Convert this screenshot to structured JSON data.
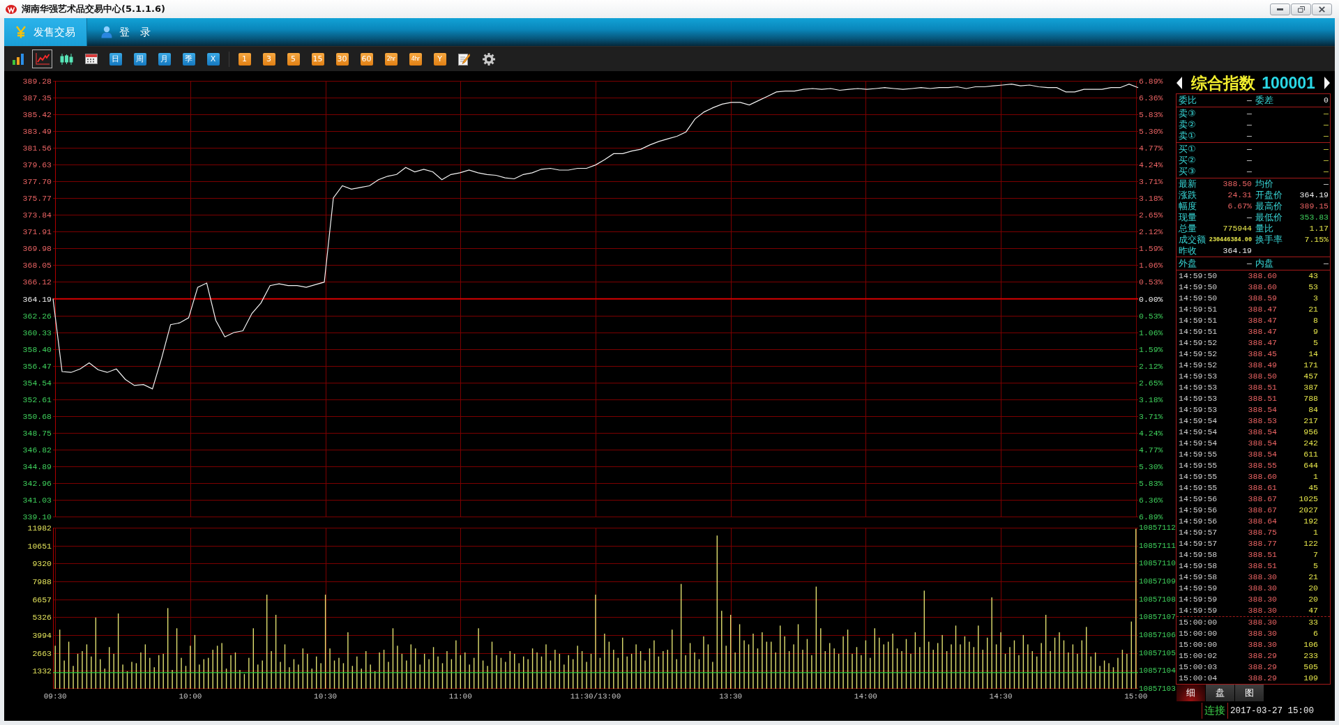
{
  "window": {
    "title": "湖南华强艺术品交易中心(5.1.1.6)"
  },
  "nav_tabs": [
    {
      "label": "发售交易",
      "selected": true
    },
    {
      "label": "登　录",
      "selected": false
    }
  ],
  "toolbar": {
    "chart_buttons": [
      {
        "selected": false
      },
      {
        "selected": true
      },
      {
        "selected": false
      },
      {
        "selected": false
      }
    ],
    "period_buttons": [
      {
        "label": "日"
      },
      {
        "label": "周"
      },
      {
        "label": "月"
      },
      {
        "label": "季"
      },
      {
        "label": "X"
      }
    ],
    "interval_buttons": [
      {
        "label": "1"
      },
      {
        "label": "3"
      },
      {
        "label": "5"
      },
      {
        "label": "15"
      },
      {
        "label": "30"
      },
      {
        "label": "60"
      },
      {
        "label": "2hr"
      },
      {
        "label": "4hr"
      },
      {
        "label": "Y"
      }
    ]
  },
  "price_chart": {
    "chart_data": {
      "type": "line",
      "grid": true,
      "ylim": [
        339.1,
        389.28
      ],
      "yticks": [
        {
          "value": 389.28,
          "label": "389.28"
        },
        {
          "value": 387.35,
          "label": "387.35"
        },
        {
          "value": 385.42,
          "label": "385.42"
        },
        {
          "value": 383.49,
          "label": "383.49"
        },
        {
          "value": 381.56,
          "label": "381.56"
        },
        {
          "value": 379.63,
          "label": "379.63"
        },
        {
          "value": 377.7,
          "label": "377.70"
        },
        {
          "value": 375.77,
          "label": "375.77"
        },
        {
          "value": 373.84,
          "label": "373.84"
        },
        {
          "value": 371.91,
          "label": "371.91"
        },
        {
          "value": 369.98,
          "label": "369.98"
        },
        {
          "value": 368.05,
          "label": "368.05"
        },
        {
          "value": 366.12,
          "label": "366.12"
        },
        {
          "value": 364.19,
          "label": "364.19"
        },
        {
          "value": 362.26,
          "label": "362.26"
        },
        {
          "value": 360.33,
          "label": "360.33"
        },
        {
          "value": 358.4,
          "label": "358.40"
        },
        {
          "value": 356.47,
          "label": "356.47"
        },
        {
          "value": 354.54,
          "label": "354.54"
        },
        {
          "value": 352.61,
          "label": "352.61"
        },
        {
          "value": 350.68,
          "label": "350.68"
        },
        {
          "value": 348.75,
          "label": "348.75"
        },
        {
          "value": 346.82,
          "label": "346.82"
        },
        {
          "value": 344.89,
          "label": "344.89"
        },
        {
          "value": 342.96,
          "label": "342.96"
        },
        {
          "value": 341.03,
          "label": "341.03"
        },
        {
          "value": 339.1,
          "label": "339.10"
        }
      ],
      "values": [
        364.2,
        355.8,
        355.7,
        356.1,
        356.8,
        356.0,
        355.7,
        356.1,
        354.9,
        354.2,
        354.3,
        353.8,
        357.3,
        361.2,
        361.4,
        362.0,
        365.5,
        366.0,
        361.7,
        359.8,
        360.3,
        360.5,
        362.5,
        363.7,
        365.7,
        365.9,
        365.7,
        365.7,
        365.5,
        365.8,
        366.1,
        375.8,
        377.2,
        376.8,
        377.0,
        377.2,
        377.9,
        378.3,
        378.5,
        379.3,
        378.8,
        379.1,
        378.8,
        377.9,
        378.5,
        378.7,
        379.0,
        378.7,
        378.5,
        378.4,
        378.1,
        378.0,
        378.5,
        378.7,
        379.1,
        379.2,
        379.0,
        379.0,
        379.2,
        379.2,
        379.6,
        380.2,
        380.9,
        380.9,
        381.2,
        381.4,
        381.9,
        382.3,
        382.6,
        382.9,
        383.4,
        384.9,
        385.7,
        386.2,
        386.6,
        386.8,
        386.8,
        386.5,
        387.0,
        387.5,
        388.0,
        388.1,
        388.1,
        388.3,
        388.4,
        388.3,
        388.4,
        388.2,
        388.3,
        388.4,
        388.3,
        388.4,
        388.5,
        388.4,
        388.3,
        388.4,
        388.5,
        388.4,
        388.5,
        388.5,
        388.6,
        388.4,
        388.6,
        388.6,
        388.7,
        388.8,
        388.9,
        388.7,
        388.8,
        388.6,
        388.5,
        388.5,
        388.0,
        388.0,
        388.3,
        388.3,
        388.3,
        388.5,
        388.5,
        388.9,
        388.5
      ],
      "ref_lines": [
        {
          "axis": "y",
          "value": 364.19
        }
      ]
    },
    "right_axis_labels": [
      "6.89%",
      "6.36%",
      "5.83%",
      "5.30%",
      "4.77%",
      "4.24%",
      "3.71%",
      "3.18%",
      "2.65%",
      "2.12%",
      "1.59%",
      "1.06%",
      "0.53%",
      "0.00%",
      "0.53%",
      "1.06%",
      "1.59%",
      "2.12%",
      "2.65%",
      "3.18%",
      "3.71%",
      "4.24%",
      "4.77%",
      "5.30%",
      "5.83%",
      "6.36%",
      "6.89%"
    ]
  },
  "volume_chart": {
    "chart_data": {
      "type": "bar",
      "grid": true,
      "ylim": [
        0,
        11982
      ],
      "yticks": [
        1332,
        2663,
        3994,
        5326,
        6657,
        7988,
        9320,
        10651,
        11982
      ],
      "categories": [
        "09:30",
        null,
        null,
        null,
        null,
        null,
        null,
        null,
        null,
        null,
        null,
        null,
        null,
        null,
        null,
        null,
        null,
        null,
        null,
        null,
        null,
        null,
        null,
        null,
        null,
        null,
        null,
        null,
        null,
        null,
        "10:00",
        null,
        null,
        null,
        null,
        null,
        null,
        null,
        null,
        null,
        null,
        null,
        null,
        null,
        null,
        null,
        null,
        null,
        null,
        null,
        null,
        null,
        null,
        null,
        null,
        null,
        null,
        null,
        null,
        null,
        "10:30",
        null,
        null,
        null,
        null,
        null,
        null,
        null,
        null,
        null,
        null,
        null,
        null,
        null,
        null,
        null,
        null,
        null,
        null,
        null,
        null,
        null,
        null,
        null,
        null,
        null,
        null,
        null,
        null,
        null,
        "11:00",
        null,
        null,
        null,
        null,
        null,
        null,
        null,
        null,
        null,
        null,
        null,
        null,
        null,
        null,
        null,
        null,
        null,
        null,
        null,
        null,
        null,
        null,
        null,
        null,
        null,
        null,
        null,
        null,
        null,
        "11:30/13:00",
        null,
        null,
        null,
        null,
        null,
        null,
        null,
        null,
        null,
        null,
        null,
        null,
        null,
        null,
        null,
        null,
        null,
        null,
        null,
        null,
        null,
        null,
        null,
        null,
        null,
        null,
        null,
        null,
        null,
        "13:30",
        null,
        null,
        null,
        null,
        null,
        null,
        null,
        null,
        null,
        null,
        null,
        null,
        null,
        null,
        null,
        null,
        null,
        null,
        null,
        null,
        null,
        null,
        null,
        null,
        null,
        null,
        null,
        null,
        null,
        "14:00",
        null,
        null,
        null,
        null,
        null,
        null,
        null,
        null,
        null,
        null,
        null,
        null,
        null,
        null,
        null,
        null,
        null,
        null,
        null,
        null,
        null,
        null,
        null,
        null,
        null,
        null,
        null,
        null,
        null,
        "14:30",
        null,
        null,
        null,
        null,
        null,
        null,
        null,
        null,
        null,
        null,
        null,
        null,
        null,
        null,
        null,
        null,
        null,
        null,
        null,
        null,
        null,
        null,
        null,
        null,
        null,
        null,
        null,
        null,
        null,
        "15:00"
      ],
      "values": [
        3200,
        4400,
        2100,
        3500,
        1700,
        2600,
        2800,
        3300,
        2400,
        5300,
        2200,
        1500,
        3100,
        2600,
        5600,
        1800,
        1300,
        2000,
        1900,
        2700,
        3300,
        2300,
        1600,
        2500,
        2600,
        6000,
        1400,
        4500,
        2300,
        1700,
        3200,
        4000,
        1800,
        2200,
        2300,
        2900,
        3200,
        3400,
        1500,
        2500,
        2700,
        1400,
        1100,
        2300,
        4500,
        1800,
        2100,
        7000,
        2800,
        5500,
        2000,
        3300,
        1600,
        2200,
        1800,
        3000,
        2600,
        1500,
        2400,
        1900,
        7000,
        3000,
        2100,
        2300,
        1900,
        4200,
        1700,
        2400,
        1500,
        2800,
        1800,
        1300,
        2700,
        2900,
        2000,
        4500,
        3200,
        2600,
        2100,
        3300,
        3000,
        1800,
        2600,
        2200,
        3100,
        2400,
        1900,
        2800,
        2200,
        3600,
        2500,
        2700,
        1800,
        2300,
        4500,
        2100,
        1700,
        3500,
        2500,
        2300,
        2000,
        2800,
        2600,
        1900,
        2400,
        2200,
        3000,
        2700,
        2400,
        3300,
        2100,
        2900,
        2600,
        1800,
        2500,
        2200,
        3200,
        2800,
        2000,
        2600,
        7000,
        2300,
        4100,
        3500,
        2900,
        2300,
        3800,
        2400,
        2600,
        3300,
        2800,
        2100,
        3000,
        3600,
        2400,
        2800,
        2900,
        4400,
        2200,
        7800,
        2500,
        3400,
        2700,
        2200,
        3900,
        3300,
        2000,
        11400,
        5800,
        3200,
        5500,
        2700,
        4800,
        3600,
        3300,
        4100,
        3000,
        4200,
        3500,
        3500,
        2700,
        4700,
        3900,
        2800,
        3300,
        4800,
        2900,
        3700,
        2500,
        7600,
        4500,
        2800,
        3400,
        3000,
        2600,
        3900,
        4400,
        2600,
        3100,
        2500,
        3600,
        2300,
        4500,
        3800,
        3300,
        3500,
        4100,
        3000,
        2800,
        3700,
        2600,
        4200,
        3100,
        7300,
        3500,
        2900,
        3400,
        4000,
        2800,
        3300,
        4700,
        3300,
        3900,
        3500,
        3100,
        4700,
        2900,
        3800,
        6800,
        3300,
        4200,
        2600,
        3100,
        3600,
        2500,
        4000,
        3300,
        2800,
        2400,
        3400,
        5500,
        2800,
        3800,
        4200,
        3600,
        2700,
        3300,
        2600,
        3600,
        4600,
        2400,
        2700,
        1700,
        2100,
        1900,
        1600,
        2300,
        2900,
        2600,
        5000,
        11900
      ],
      "ref_lines": [
        {
          "axis": "y",
          "value": 1200
        }
      ]
    },
    "right_axis_labels": [
      "10857112",
      "10857111",
      "10857110",
      "10857109",
      "10857108",
      "10857107",
      "10857106",
      "10857105",
      "10857104",
      "10857103"
    ]
  },
  "quote_panel": {
    "name": "综合指数",
    "code": "100001",
    "sections": [
      {
        "rows": [
          {
            "kind": "pair",
            "cells": [
              {
                "label": "委比",
                "value": "—"
              },
              {
                "label": "委差",
                "value": "0"
              }
            ]
          }
        ]
      },
      {
        "rows": [
          {
            "kind": "level",
            "label": "卖③",
            "price": "—",
            "volume": "—"
          },
          {
            "kind": "level",
            "label": "卖②",
            "price": "—",
            "volume": "—"
          },
          {
            "kind": "level",
            "label": "卖①",
            "price": "—",
            "volume": "—"
          }
        ]
      },
      {
        "rows": [
          {
            "kind": "level",
            "label": "买①",
            "price": "—",
            "volume": "—"
          },
          {
            "kind": "level",
            "label": "买②",
            "price": "—",
            "volume": "—"
          },
          {
            "kind": "level",
            "label": "买③",
            "price": "—",
            "volume": "—"
          }
        ]
      },
      {
        "rows": [
          {
            "kind": "pair",
            "cells": [
              {
                "label": "最新",
                "value": "388.50",
                "color": "#ec6464"
              },
              {
                "label": "均价",
                "value": "—"
              }
            ]
          },
          {
            "kind": "pair",
            "cells": [
              {
                "label": "涨跌",
                "value": "24.31",
                "color": "#ec6464"
              },
              {
                "label": "开盘价",
                "value": "364.19"
              }
            ]
          },
          {
            "kind": "pair",
            "cells": [
              {
                "label": "幅度",
                "value": "6.67%",
                "color": "#ec6464"
              },
              {
                "label": "最高价",
                "value": "389.15",
                "color": "#ec6464"
              }
            ]
          },
          {
            "kind": "pair",
            "cells": [
              {
                "label": "现量",
                "value": "—"
              },
              {
                "label": "最低价",
                "value": "353.83",
                "color": "#3fd15c"
              }
            ]
          },
          {
            "kind": "pair",
            "cells": [
              {
                "label": "总量",
                "value": "775944",
                "color": "#e8e84c"
              },
              {
                "label": "量比",
                "value": "1.17",
                "color": "#e8e84c"
              }
            ]
          },
          {
            "kind": "pair",
            "cells": [
              {
                "label": "成交额",
                "value": "230446384.00",
                "color": "#e8e84c"
              },
              {
                "label": "换手率",
                "value": "7.15%",
                "color": "#e8e84c"
              }
            ]
          },
          {
            "kind": "pair",
            "cells": [
              {
                "label": "昨收",
                "value": "364.19"
              }
            ]
          }
        ]
      },
      {
        "rows": [
          {
            "kind": "pair",
            "cells": [
              {
                "label": "外盘",
                "value": "—"
              },
              {
                "label": "内盘",
                "value": "—"
              }
            ]
          }
        ]
      }
    ],
    "tick_groups": [
      {
        "rows": [
          {
            "time": "14:59:50",
            "price": "388.60",
            "volume": "43"
          },
          {
            "time": "14:59:50",
            "price": "388.60",
            "volume": "53"
          },
          {
            "time": "14:59:50",
            "price": "388.59",
            "volume": "3"
          },
          {
            "time": "14:59:51",
            "price": "388.47",
            "volume": "21"
          },
          {
            "time": "14:59:51",
            "price": "388.47",
            "volume": "8"
          },
          {
            "time": "14:59:51",
            "price": "388.47",
            "volume": "9"
          },
          {
            "time": "14:59:52",
            "price": "388.47",
            "volume": "5"
          },
          {
            "time": "14:59:52",
            "price": "388.45",
            "volume": "14"
          },
          {
            "time": "14:59:52",
            "price": "388.49",
            "volume": "171"
          },
          {
            "time": "14:59:53",
            "price": "388.50",
            "volume": "457"
          },
          {
            "time": "14:59:53",
            "price": "388.51",
            "volume": "387"
          },
          {
            "time": "14:59:53",
            "price": "388.51",
            "volume": "788"
          },
          {
            "time": "14:59:53",
            "price": "388.54",
            "volume": "84"
          },
          {
            "time": "14:59:54",
            "price": "388.53",
            "volume": "217"
          },
          {
            "time": "14:59:54",
            "price": "388.54",
            "volume": "956"
          },
          {
            "time": "14:59:54",
            "price": "388.54",
            "volume": "242"
          },
          {
            "time": "14:59:55",
            "price": "388.54",
            "volume": "611"
          },
          {
            "time": "14:59:55",
            "price": "388.55",
            "volume": "644"
          },
          {
            "time": "14:59:55",
            "price": "388.60",
            "volume": "1"
          },
          {
            "time": "14:59:55",
            "price": "388.61",
            "volume": "45"
          },
          {
            "time": "14:59:56",
            "price": "388.67",
            "volume": "1025"
          },
          {
            "time": "14:59:56",
            "price": "388.67",
            "volume": "2027"
          },
          {
            "time": "14:59:56",
            "price": "388.64",
            "volume": "192"
          },
          {
            "time": "14:59:57",
            "price": "388.75",
            "volume": "1"
          },
          {
            "time": "14:59:57",
            "price": "388.77",
            "volume": "122"
          },
          {
            "time": "14:59:58",
            "price": "388.51",
            "volume": "7"
          },
          {
            "time": "14:59:58",
            "price": "388.51",
            "volume": "5"
          },
          {
            "time": "14:59:58",
            "price": "388.30",
            "volume": "21"
          },
          {
            "time": "14:59:59",
            "price": "388.30",
            "volume": "20"
          },
          {
            "time": "14:59:59",
            "price": "388.30",
            "volume": "20"
          },
          {
            "time": "14:59:59",
            "price": "388.30",
            "volume": "47"
          }
        ]
      },
      {
        "rows": [
          {
            "time": "15:00:00",
            "price": "388.30",
            "volume": "33"
          },
          {
            "time": "15:00:00",
            "price": "388.30",
            "volume": "6"
          },
          {
            "time": "15:00:00",
            "price": "388.30",
            "volume": "106"
          },
          {
            "time": "15:00:02",
            "price": "388.29",
            "volume": "233"
          },
          {
            "time": "15:00:03",
            "price": "388.29",
            "volume": "505"
          },
          {
            "time": "15:00:04",
            "price": "388.29",
            "volume": "109"
          }
        ]
      }
    ],
    "tabs": [
      {
        "label": "细",
        "selected": true
      },
      {
        "label": "盘",
        "selected": false
      },
      {
        "label": "图",
        "selected": false
      }
    ]
  },
  "status_bar": {
    "connection": "连接",
    "datetime": "2017-03-27 15:00"
  }
}
